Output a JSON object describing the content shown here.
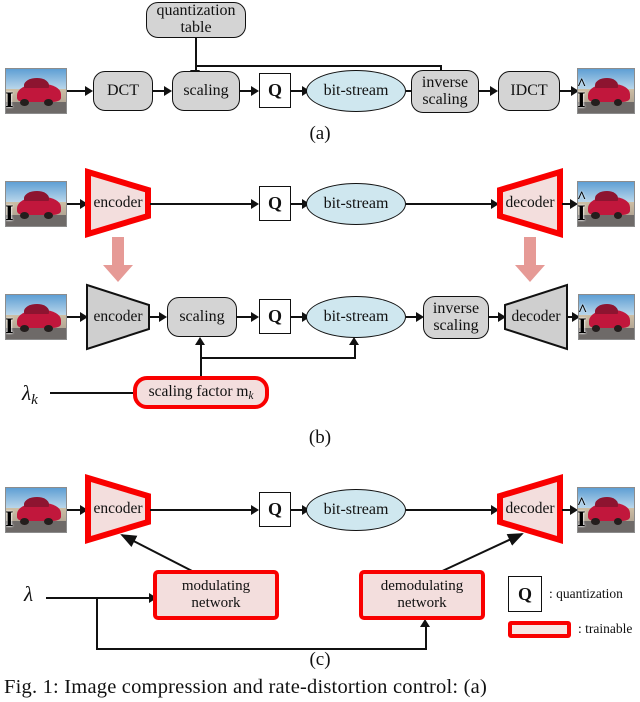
{
  "figure": {
    "caption": "Fig. 1: Image compression and rate-distortion control: (a)",
    "sub_labels": {
      "a": "(a)",
      "b": "(b)",
      "c": "(c)"
    }
  },
  "panel_a": {
    "input_image_label": "I",
    "output_image_label": "I",
    "nodes": {
      "quantization_table": "quantization\ntable",
      "dct": "DCT",
      "scaling": "scaling",
      "quantizer": "Q",
      "bitstream": "bit-stream",
      "inverse_scaling": "inverse\nscaling",
      "idct": "IDCT"
    }
  },
  "panel_b": {
    "row1": {
      "input_image_label": "I",
      "output_image_label": "I",
      "encoder": "encoder",
      "quantizer": "Q",
      "bitstream": "bit-stream",
      "decoder": "decoder"
    },
    "row2": {
      "input_image_label": "I",
      "output_image_label": "I",
      "encoder": "encoder",
      "scaling": "scaling",
      "quantizer": "Q",
      "bitstream": "bit-stream",
      "inverse_scaling": "inverse\nscaling",
      "decoder": "decoder"
    },
    "lambda_label": "λ",
    "lambda_sub": "k",
    "scaling_factor_text": "scaling factor ",
    "scaling_factor_sym": "m",
    "scaling_factor_sub": "k"
  },
  "panel_c": {
    "input_image_label": "I",
    "output_image_label": "I",
    "encoder": "encoder",
    "quantizer": "Q",
    "bitstream": "bit-stream",
    "decoder": "decoder",
    "lambda_label": "λ",
    "modulating_network": "modulating\nnetwork",
    "demodulating_network": "demodulating\nnetwork"
  },
  "legend": {
    "quantization_symbol": "Q",
    "quantization_text": ": quantization",
    "trainable_text": ": trainable"
  },
  "colors": {
    "trainable_border": "#f90000",
    "trainable_fill": "#f3dedd",
    "node_fill": "#d4d4d4",
    "bitstream_fill": "#cfe7ef",
    "pink_arrow": "#e69a96",
    "line": "#111111"
  }
}
